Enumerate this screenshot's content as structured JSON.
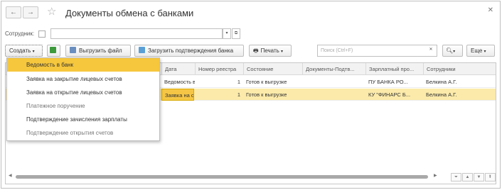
{
  "title": "Документы обмена с банками",
  "filter": {
    "label": "Сотрудник:",
    "value": ""
  },
  "toolbar": {
    "create_label": "Создать",
    "export_label": "Выгрузить файл",
    "load_label": "Загрузить подтверждения банка",
    "print_label": "Печать",
    "search_placeholder": "Поиск (Ctrl+F)",
    "more_label": "Еще"
  },
  "columns": [
    "Дата",
    "Номер реестра",
    "Состояние",
    "Документы-Подтв...",
    "Зарплатный про...",
    "Сотрудники"
  ],
  "rows": [
    {
      "doc": "Ведомость в банк",
      "number": "1",
      "status": "Готов к выгрузке",
      "confirm": "",
      "project": "ПУ БАНКА РО...",
      "employee": "Белкина А.Г."
    },
    {
      "doc": "Заявка на откр...",
      "number": "1",
      "status": "Готов к выгрузке",
      "confirm": "",
      "project": "КУ \"ФИНАРС Б...",
      "employee": "Белкина А.Г."
    }
  ],
  "menu": [
    "Ведомость в банк",
    "Заявка на закрытие лицевых счетов",
    "Заявка на открытие лицевых счетов",
    "Платежное поручение",
    "Подтверждение зачисления зарплаты",
    "Подтверждение открытия счетов"
  ],
  "colors": {
    "highlight": "#f6c73d",
    "selected_row": "#fbeaaa"
  }
}
